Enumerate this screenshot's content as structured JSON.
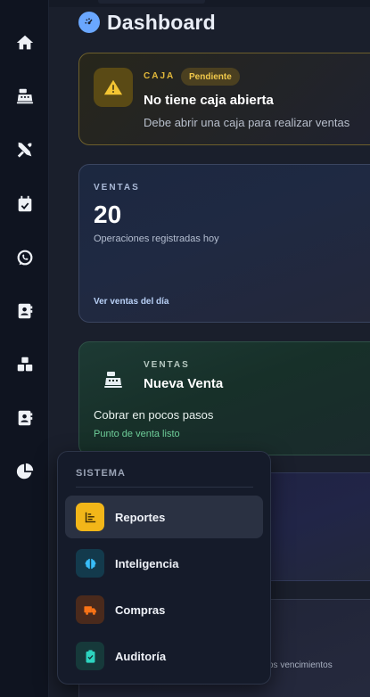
{
  "header": {
    "title": "Dashboard"
  },
  "sidebar": {
    "items": [
      {
        "icon": "home-icon"
      },
      {
        "icon": "cash-register-icon"
      },
      {
        "icon": "tools-icon"
      },
      {
        "icon": "calendar-check-icon"
      },
      {
        "icon": "whatsapp-icon"
      },
      {
        "icon": "contact-book-icon"
      },
      {
        "icon": "boxes-icon"
      },
      {
        "icon": "address-book-icon"
      },
      {
        "icon": "pie-chart-icon"
      }
    ]
  },
  "caja_card": {
    "kicker": "CAJA",
    "badge": "Pendiente",
    "title": "No tiene caja abierta",
    "description": "Debe abrir una caja para realizar ventas",
    "icon": "warning-icon",
    "accent": "#e3b93a"
  },
  "ventas_card": {
    "kicker": "VENTAS",
    "count": "20",
    "subtitle": "Operaciones registradas hoy",
    "link": "Ver ventas del día"
  },
  "nueva_venta_card": {
    "kicker": "VENTAS",
    "title": "Nueva Venta",
    "description": "Cobrar en pocos pasos",
    "subtitle": "Punto de venta listo",
    "icon": "cash-register-icon",
    "accent": "#6fcf9a"
  },
  "partial_card": {
    "text": "os vencimientos"
  },
  "sistema_menu": {
    "heading": "SISTEMA",
    "items": [
      {
        "label": "Reportes",
        "icon": "report-chart-icon",
        "color": "#f2b619",
        "active": true
      },
      {
        "label": "Inteligencia",
        "icon": "brain-icon",
        "color": "#38bdf8",
        "active": false
      },
      {
        "label": "Compras",
        "icon": "truck-icon",
        "color": "#f97316",
        "active": false
      },
      {
        "label": "Auditoría",
        "icon": "clipboard-check-icon",
        "color": "#2dd4bf",
        "active": false
      }
    ]
  }
}
